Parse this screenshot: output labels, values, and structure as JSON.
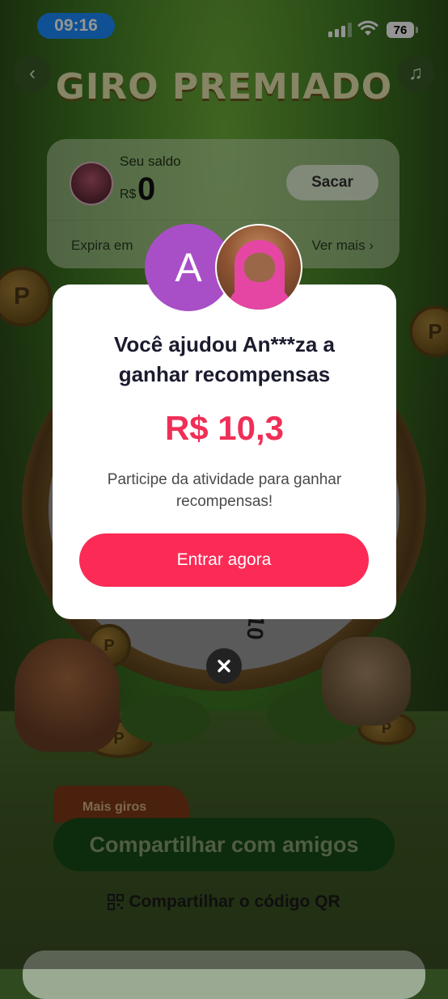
{
  "status_bar": {
    "time": "09:16",
    "battery": "76"
  },
  "header": {
    "title": "GIRO PREMIADO"
  },
  "balance_card": {
    "label": "Seu saldo",
    "currency": "R$",
    "amount": "0",
    "withdraw_label": "Sacar",
    "expires_label": "Expira em",
    "see_more_label": "Ver mais"
  },
  "wheel": {
    "visible_number": "10"
  },
  "actions": {
    "more_spins_badge": "Mais giros",
    "share_button": "Compartilhar com amigos",
    "qr_link": "Compartilhar o código QR"
  },
  "modal": {
    "avatar_letter": "A",
    "headline_line1": "Você ajudou An***za a",
    "headline_line2": "ganhar recompensas",
    "amount": "R$ 10,3",
    "description": "Participe da atividade para ganhar recompensas!",
    "cta_label": "Entrar agora"
  },
  "icons": {
    "back": "chevron-left-icon",
    "music": "music-note-icon",
    "close": "close-icon",
    "qr": "qr-code-icon",
    "wifi": "wifi-icon",
    "signal": "signal-icon",
    "battery": "battery-icon"
  },
  "colors": {
    "accent": "#fc2b56",
    "amount": "#ef2f57",
    "status_pill": "#1a8cff",
    "avatar_purple": "#a84fc8"
  }
}
